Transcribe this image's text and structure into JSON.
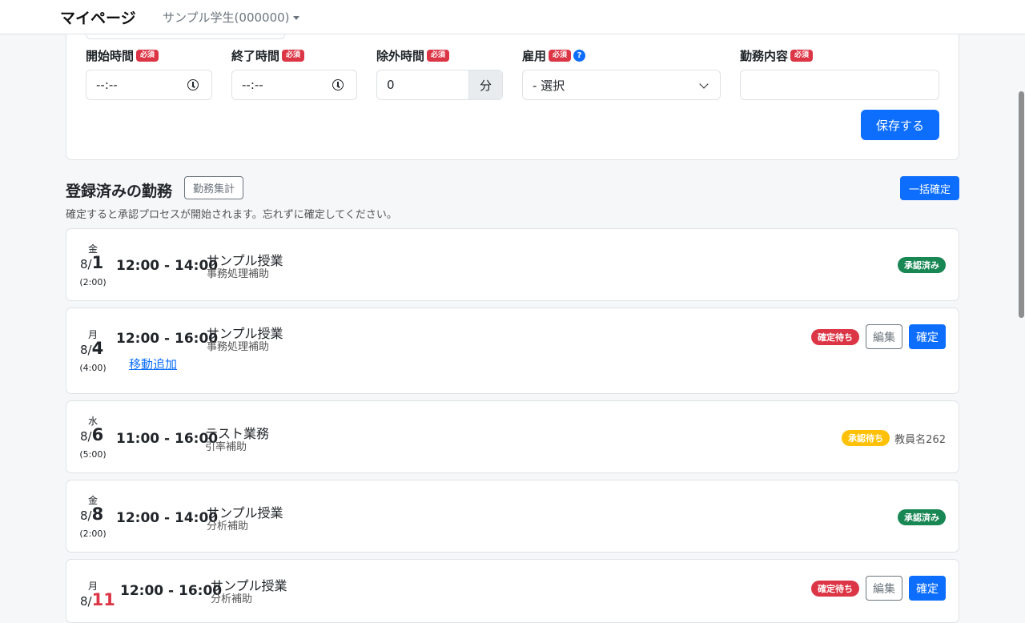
{
  "navbar": {
    "brand": "マイページ",
    "user": "サンプル学生(000000)"
  },
  "form": {
    "start_label": "開始時間",
    "end_label": "終了時間",
    "exclude_label": "除外時間",
    "employment_label": "雇用",
    "content_label": "勤務内容",
    "required_badge": "必須",
    "help_glyph": "?",
    "start_value": "--:--",
    "end_value": "--:--",
    "exclude_value": "0",
    "exclude_unit": "分",
    "employment_value": "- 選択",
    "content_value": "",
    "save_label": "保存する"
  },
  "section": {
    "title": "登録済みの勤務",
    "summary_label": "勤務集計",
    "bulk_label": "一括確定",
    "description": "確定すると承認プロセスが開始されます。忘れずに確定してください。"
  },
  "entries": [
    {
      "dow": "金",
      "month": "8/",
      "day": "1",
      "duration": "(2:00)",
      "time": "12:00 - 14:00",
      "title": "サンプル授業",
      "subtitle": "事務処理補助",
      "status": "承認済み",
      "status_color": "#198754"
    },
    {
      "dow": "月",
      "month": "8/",
      "day": "4",
      "duration": "(4:00)",
      "time": "12:00 - 16:00",
      "title": "サンプル授業",
      "subtitle": "事務処理補助",
      "link": "移動追加",
      "status": "確定待ち",
      "status_color": "#dc3545",
      "edit_label": "編集",
      "confirm_label": "確定"
    },
    {
      "dow": "水",
      "month": "8/",
      "day": "6",
      "duration": "(5:00)",
      "time": "11:00 - 16:00",
      "title": "テスト業務",
      "subtitle": "引率補助",
      "status": "承認待ち",
      "status_color": "#ffc107",
      "teacher": "教員名262"
    },
    {
      "dow": "金",
      "month": "8/",
      "day": "8",
      "duration": "(2:00)",
      "time": "12:00 - 14:00",
      "title": "サンプル授業",
      "subtitle": "分析補助",
      "status": "承認済み",
      "status_color": "#198754"
    },
    {
      "dow": "月",
      "month": "8/",
      "day": "11",
      "time": "12:00 - 16:00",
      "title": "サンプル授業",
      "subtitle": "分析補助",
      "status": "確定待ち",
      "status_color": "#dc3545",
      "edit_label": "編集",
      "confirm_label": "確定"
    }
  ]
}
